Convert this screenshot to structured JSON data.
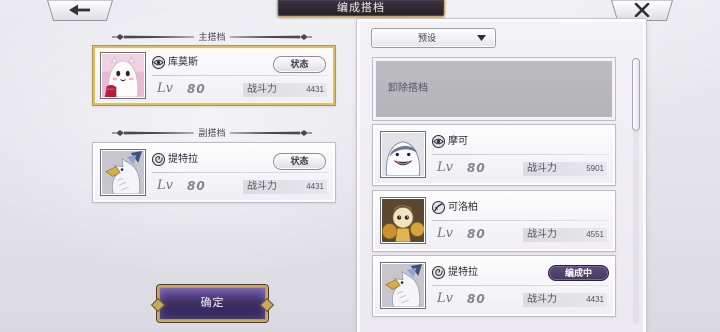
{
  "header": {
    "title": "编成搭档",
    "back_icon": "arrow-left-icon",
    "close_icon": "close-icon"
  },
  "labels": {
    "lv": "Lv",
    "power": "战斗力",
    "status": "状态"
  },
  "left_panel": {
    "main_label": "主搭档",
    "sub_label": "副搭档",
    "main_partner": {
      "name": "库莫斯",
      "element_icon": "eye-element-icon",
      "level": "80",
      "power": "4431",
      "selected": true
    },
    "sub_partner": {
      "name": "提特拉",
      "element_icon": "spiral-element-icon",
      "level": "80",
      "power": "4431",
      "selected": false
    },
    "confirm_label": "确定"
  },
  "right_panel": {
    "preset_label": "预设",
    "preset_caret_icon": "caret-down-icon",
    "unequip_label": "卸除搭档",
    "partners": [
      {
        "name": "摩可",
        "element_icon": "eye-element-icon",
        "level": "80",
        "power": "5901"
      },
      {
        "name": "可洛柏",
        "element_icon": "slash-element-icon",
        "level": "80",
        "power": "4551"
      },
      {
        "name": "提特拉",
        "element_icon": "spiral-element-icon",
        "level": "80",
        "power": "4431",
        "badge": "编成中"
      }
    ]
  },
  "colors": {
    "gold_trim": "#c9a862",
    "selected_border": "#dcbc6d",
    "badge_bg": "#46395e",
    "confirm_bg": "#3f3168",
    "title_bg": "#24202a",
    "unequip_bg": "#b5b4b9"
  }
}
